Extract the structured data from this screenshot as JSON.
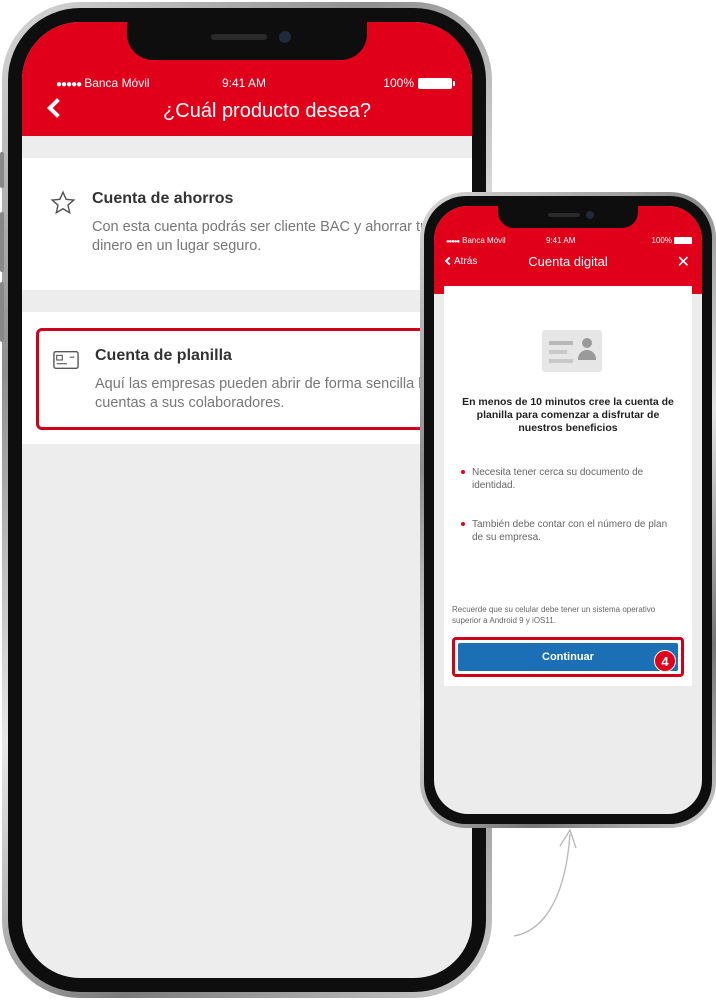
{
  "big_phone": {
    "status": {
      "carrier": "Banca Móvil",
      "time": "9:41 AM",
      "battery": "100%"
    },
    "nav": {
      "title": "¿Cuál producto desea?"
    },
    "options": [
      {
        "title": "Cuenta de ahorros",
        "description": "Con esta cuenta podrás ser cliente BAC y ahorrar tu dinero en un lugar seguro.",
        "icon": "star-icon"
      },
      {
        "title": "Cuenta de planilla",
        "description": "Aquí las empresas pueden abrir de forma sencilla las cuentas a sus colaboradores.",
        "icon": "id-card-icon"
      }
    ]
  },
  "small_phone": {
    "status": {
      "carrier": "Banca Móvil",
      "time": "9:41 AM",
      "battery": "100%"
    },
    "nav": {
      "back": "Atrás",
      "title": "Cuenta digital",
      "close": "✕"
    },
    "heading": "En menos de 10 minutos cree la cuenta de planilla para comenzar a disfrutar de nuestros beneficios",
    "bullets": [
      "Necesita tener cerca su documento de identidad.",
      "También debe contar con el número de plan de su empresa."
    ],
    "note": "Recuerde que su celular debe tener un sistema operativo superior a Android 9 y iOS11.",
    "button": "Continuar",
    "step": "4"
  },
  "colors": {
    "brand_red": "#e0001a",
    "button_blue": "#1a6fb5",
    "highlight": "#d0021b"
  }
}
